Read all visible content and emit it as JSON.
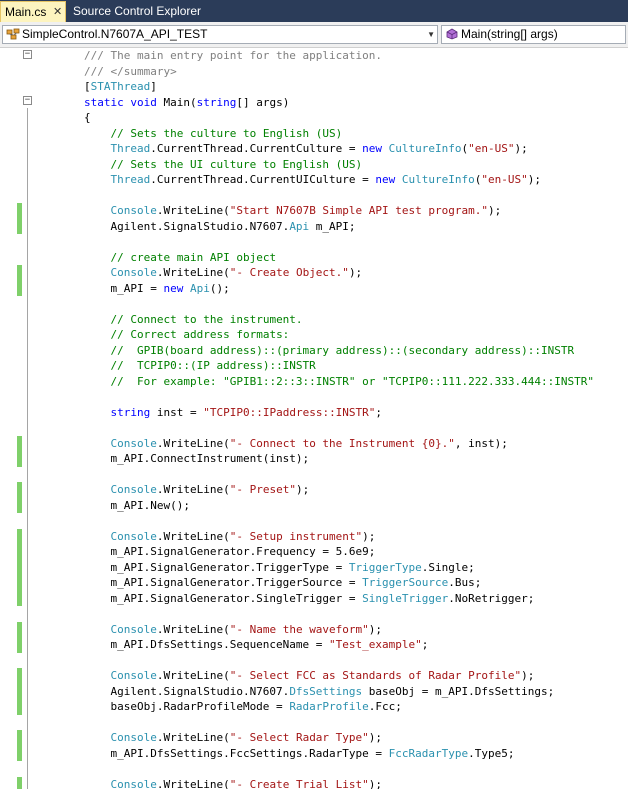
{
  "tabs": [
    {
      "label": "Main.cs",
      "active": true
    },
    {
      "label": "Source Control Explorer",
      "active": false
    }
  ],
  "nav": {
    "class_combo": "SimpleControl.N7607A_API_TEST",
    "member_combo": "Main(string[] args)"
  },
  "colors": {
    "keyword": "#0000ff",
    "type": "#2b91af",
    "string": "#a31515",
    "comment": "#008000",
    "doc": "#808080",
    "changed_margin": "#7fd06a"
  },
  "code_lines": [
    [
      [
        "doc",
        "/// The main entry point for the application."
      ]
    ],
    [
      [
        "doc",
        "/// </summary>"
      ]
    ],
    [
      [
        "plain",
        "["
      ],
      [
        "type",
        "STAThread"
      ],
      [
        "plain",
        "]"
      ]
    ],
    [
      [
        "kw",
        "static void "
      ],
      [
        "plain",
        "Main("
      ],
      [
        "kw",
        "string"
      ],
      [
        "plain",
        "[] args)"
      ]
    ],
    [
      [
        "plain",
        "{"
      ]
    ],
    [
      [
        "plain",
        "    "
      ],
      [
        "comment",
        "// Sets the culture to English (US)"
      ]
    ],
    [
      [
        "plain",
        "    "
      ],
      [
        "type",
        "Thread"
      ],
      [
        "plain",
        ".CurrentThread.CurrentCulture = "
      ],
      [
        "kw",
        "new "
      ],
      [
        "type",
        "CultureInfo"
      ],
      [
        "plain",
        "("
      ],
      [
        "str",
        "\"en-US\""
      ],
      [
        "plain",
        ");"
      ]
    ],
    [
      [
        "plain",
        "    "
      ],
      [
        "comment",
        "// Sets the UI culture to English (US)"
      ]
    ],
    [
      [
        "plain",
        "    "
      ],
      [
        "type",
        "Thread"
      ],
      [
        "plain",
        ".CurrentThread.CurrentUICulture = "
      ],
      [
        "kw",
        "new "
      ],
      [
        "type",
        "CultureInfo"
      ],
      [
        "plain",
        "("
      ],
      [
        "str",
        "\"en-US\""
      ],
      [
        "plain",
        ");"
      ]
    ],
    [],
    [
      [
        "plain",
        "    "
      ],
      [
        "type",
        "Console"
      ],
      [
        "plain",
        ".WriteLine("
      ],
      [
        "str",
        "\"Start N7607B Simple API test program.\""
      ],
      [
        "plain",
        ");"
      ]
    ],
    [
      [
        "plain",
        "    Agilent.SignalStudio.N7607."
      ],
      [
        "type",
        "Api"
      ],
      [
        "plain",
        " m_API;"
      ]
    ],
    [],
    [
      [
        "plain",
        "    "
      ],
      [
        "comment",
        "// create main API object"
      ]
    ],
    [
      [
        "plain",
        "    "
      ],
      [
        "type",
        "Console"
      ],
      [
        "plain",
        ".WriteLine("
      ],
      [
        "str",
        "\"- Create Object.\""
      ],
      [
        "plain",
        ");"
      ]
    ],
    [
      [
        "plain",
        "    m_API = "
      ],
      [
        "kw",
        "new "
      ],
      [
        "type",
        "Api"
      ],
      [
        "plain",
        "();"
      ]
    ],
    [],
    [
      [
        "plain",
        "    "
      ],
      [
        "comment",
        "// Connect to the instrument."
      ]
    ],
    [
      [
        "plain",
        "    "
      ],
      [
        "comment",
        "// Correct address formats:"
      ]
    ],
    [
      [
        "plain",
        "    "
      ],
      [
        "comment",
        "//  GPIB(board address)::(primary address)::(secondary address)::INSTR"
      ]
    ],
    [
      [
        "plain",
        "    "
      ],
      [
        "comment",
        "//  TCPIP0::(IP address)::INSTR"
      ]
    ],
    [
      [
        "plain",
        "    "
      ],
      [
        "comment",
        "//  For example: \"GPIB1::2::3::INSTR\" or \"TCPIP0::111.222.333.444::INSTR\""
      ]
    ],
    [],
    [
      [
        "plain",
        "    "
      ],
      [
        "kw",
        "string"
      ],
      [
        "plain",
        " inst = "
      ],
      [
        "str",
        "\"TCPIP0::IPaddress::INSTR\""
      ],
      [
        "plain",
        ";"
      ]
    ],
    [],
    [
      [
        "plain",
        "    "
      ],
      [
        "type",
        "Console"
      ],
      [
        "plain",
        ".WriteLine("
      ],
      [
        "str",
        "\"- Connect to the Instrument {0}.\""
      ],
      [
        "plain",
        ", inst);"
      ]
    ],
    [
      [
        "plain",
        "    m_API.ConnectInstrument(inst);"
      ]
    ],
    [],
    [
      [
        "plain",
        "    "
      ],
      [
        "type",
        "Console"
      ],
      [
        "plain",
        ".WriteLine("
      ],
      [
        "str",
        "\"- Preset\""
      ],
      [
        "plain",
        ");"
      ]
    ],
    [
      [
        "plain",
        "    m_API.New();"
      ]
    ],
    [],
    [
      [
        "plain",
        "    "
      ],
      [
        "type",
        "Console"
      ],
      [
        "plain",
        ".WriteLine("
      ],
      [
        "str",
        "\"- Setup instrument\""
      ],
      [
        "plain",
        ");"
      ]
    ],
    [
      [
        "plain",
        "    m_API.SignalGenerator.Frequency = 5.6e9;"
      ]
    ],
    [
      [
        "plain",
        "    m_API.SignalGenerator.TriggerType = "
      ],
      [
        "type",
        "TriggerType"
      ],
      [
        "plain",
        ".Single;"
      ]
    ],
    [
      [
        "plain",
        "    m_API.SignalGenerator.TriggerSource = "
      ],
      [
        "type",
        "TriggerSource"
      ],
      [
        "plain",
        ".Bus;"
      ]
    ],
    [
      [
        "plain",
        "    m_API.SignalGenerator.SingleTrigger = "
      ],
      [
        "type",
        "SingleTrigger"
      ],
      [
        "plain",
        ".NoRetrigger;"
      ]
    ],
    [],
    [
      [
        "plain",
        "    "
      ],
      [
        "type",
        "Console"
      ],
      [
        "plain",
        ".WriteLine("
      ],
      [
        "str",
        "\"- Name the waveform\""
      ],
      [
        "plain",
        ");"
      ]
    ],
    [
      [
        "plain",
        "    m_API.DfsSettings.SequenceName = "
      ],
      [
        "str",
        "\"Test_example\""
      ],
      [
        "plain",
        ";"
      ]
    ],
    [],
    [
      [
        "plain",
        "    "
      ],
      [
        "type",
        "Console"
      ],
      [
        "plain",
        ".WriteLine("
      ],
      [
        "str",
        "\"- Select FCC as Standards of Radar Profile\""
      ],
      [
        "plain",
        ");"
      ]
    ],
    [
      [
        "plain",
        "    Agilent.SignalStudio.N7607."
      ],
      [
        "type",
        "DfsSettings"
      ],
      [
        "plain",
        " baseObj = m_API.DfsSettings;"
      ]
    ],
    [
      [
        "plain",
        "    baseObj.RadarProfileMode = "
      ],
      [
        "type",
        "RadarProfile"
      ],
      [
        "plain",
        ".Fcc;"
      ]
    ],
    [],
    [
      [
        "plain",
        "    "
      ],
      [
        "type",
        "Console"
      ],
      [
        "plain",
        ".WriteLine("
      ],
      [
        "str",
        "\"- Select Radar Type\""
      ],
      [
        "plain",
        ");"
      ]
    ],
    [
      [
        "plain",
        "    m_API.DfsSettings.FccSettings.RadarType = "
      ],
      [
        "type",
        "FccRadarType"
      ],
      [
        "plain",
        ".Type5;"
      ]
    ],
    [],
    [
      [
        "plain",
        "    "
      ],
      [
        "type",
        "Console"
      ],
      [
        "plain",
        ".WriteLine("
      ],
      [
        "str",
        "\"- Create Trial List\""
      ],
      [
        "plain",
        ");"
      ]
    ]
  ],
  "changed_lines": [
    10,
    11,
    14,
    15,
    25,
    26,
    28,
    29,
    31,
    32,
    33,
    34,
    35,
    37,
    38,
    40,
    41,
    42,
    44,
    45,
    47
  ]
}
